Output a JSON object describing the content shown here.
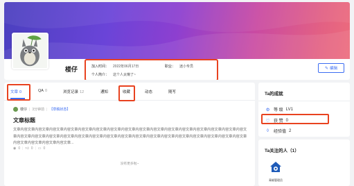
{
  "profile": {
    "username": "楼仔",
    "join_label": "加入时间：",
    "join_date": "2022年06月17日",
    "job_label": "职业：",
    "job_value": "迷小专员",
    "bio_label": "个人简介：",
    "bio_value": "这个人太懒了~",
    "edit_label": "编辑"
  },
  "tabs": [
    {
      "label": "文章",
      "count": "0"
    },
    {
      "label": "QA",
      "count": "0"
    },
    {
      "label": "浏览记录",
      "count": "12"
    },
    {
      "label": "通知",
      "count": ""
    },
    {
      "label": "收藏",
      "count": ""
    },
    {
      "label": "动态",
      "count": ""
    },
    {
      "label": "随写",
      "count": ""
    }
  ],
  "article": {
    "author": "楼仔",
    "time": "3分钟前",
    "tag": "【草稿状态】",
    "title": "文章标题",
    "body": "文章内容文章内容文章内容文章内容文章内容文章内容文章内容文章内容文章内容文章内容文章内容文章内容文章内容文章内容文章内容文章内容文章内容文章内容文章内容文章内容文章内容文章内容文章内容文章内容文章内容文章内容文章内容文章内容文章内容文章内容文章内容文章内容文章内容文章内容文章内容文章内容文章...",
    "views": "0",
    "likes": "0",
    "comments": "0"
  },
  "no_more": "没有更多啦~",
  "achievements": {
    "title": "Ta的成就",
    "level_label": "等  级",
    "level_value": "LV1",
    "praise_label": "获  赞",
    "praise_value": "0",
    "exp_label": "经验值",
    "exp_value": "2"
  },
  "following": {
    "title": "Ta关注的人（1）",
    "items": [
      {
        "name": "青椒管理员"
      }
    ]
  },
  "colors": {
    "accent": "#3b6cf2",
    "highlight": "#e8421f"
  }
}
